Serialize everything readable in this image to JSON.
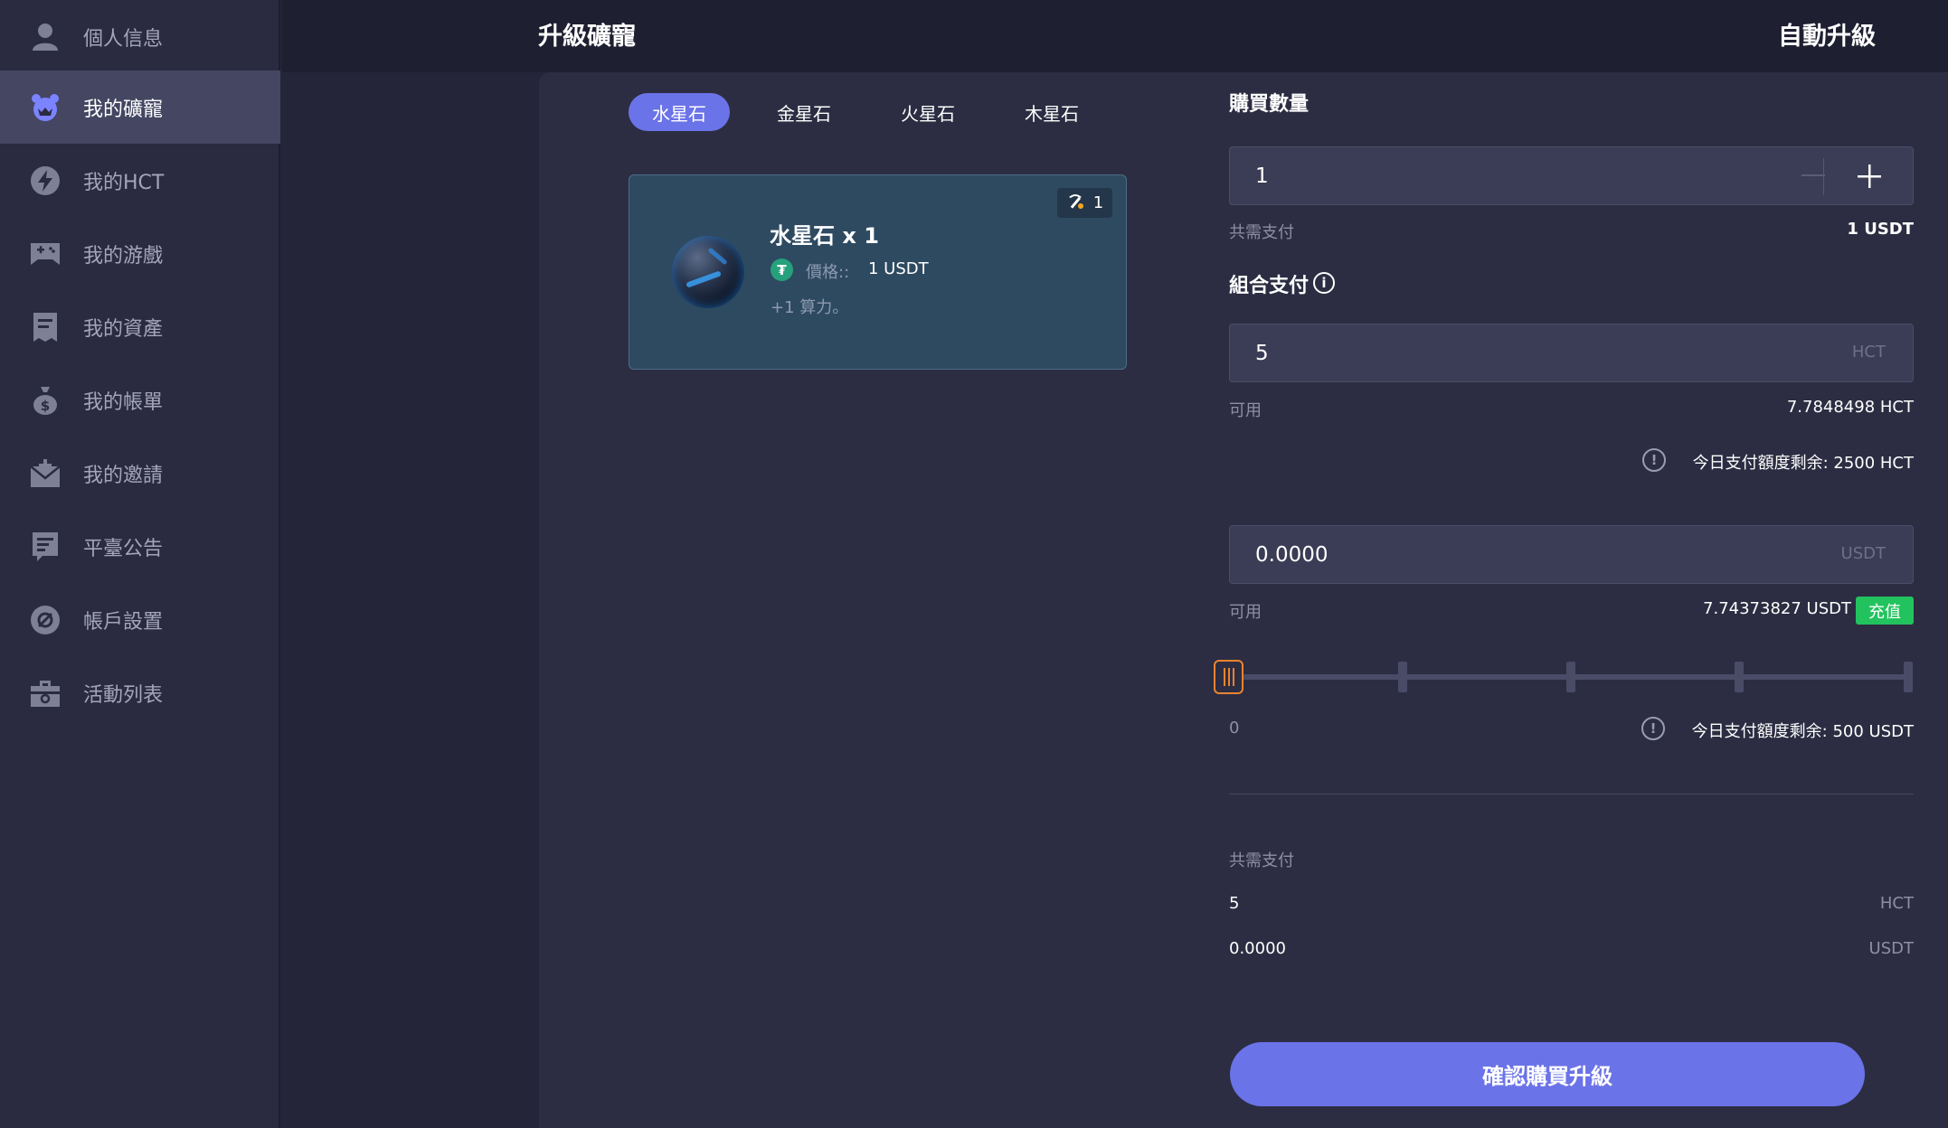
{
  "sidebar": {
    "items": [
      {
        "label": "個人信息",
        "icon": "user-icon"
      },
      {
        "label": "我的礦寵",
        "icon": "pet-icon",
        "active": true
      },
      {
        "label": "我的HCT",
        "icon": "lightning-icon"
      },
      {
        "label": "我的游戲",
        "icon": "gamepad-icon"
      },
      {
        "label": "我的資產",
        "icon": "document-icon"
      },
      {
        "label": "我的帳單",
        "icon": "money-bag-icon"
      },
      {
        "label": "我的邀請",
        "icon": "mail-plus-icon"
      },
      {
        "label": "平臺公告",
        "icon": "announcement-icon"
      },
      {
        "label": "帳戶設置",
        "icon": "settings-icon"
      },
      {
        "label": "活動列表",
        "icon": "toolbox-icon"
      }
    ]
  },
  "header": {
    "title": "升級礦寵",
    "auto_upgrade": "自動升級"
  },
  "tabs": [
    {
      "label": "水星石",
      "active": true
    },
    {
      "label": "金星石"
    },
    {
      "label": "火星石"
    },
    {
      "label": "木星石"
    }
  ],
  "card": {
    "title": "水星石 x 1",
    "coin_symbol": "₮",
    "price_label": "價格::",
    "price_value": "1 USDT",
    "power": "+1 算力。",
    "badge_count": "1"
  },
  "form": {
    "quantity_label": "購買數量",
    "quantity_value": "1",
    "total_label": "共需支付",
    "total_value": "1 USDT",
    "combo_label": "組合支付",
    "hct_value": "5",
    "hct_unit": "HCT",
    "hct_available_label": "可用",
    "hct_available_value": "7.7848498 HCT",
    "hct_limit_text": "今日支付額度剩余: 2500 HCT",
    "usdt_value": "0.0000",
    "usdt_unit": "USDT",
    "usdt_available_label": "可用",
    "usdt_available_value": "7.74373827 USDT",
    "recharge_label": "充值",
    "slider_min": "0",
    "slider_value_fraction": 0,
    "usdt_limit_text": "今日支付額度剩余: 500 USDT",
    "summary_label": "共需支付",
    "summary_hct_value": "5",
    "summary_hct_unit": "HCT",
    "summary_usdt_value": "0.0000",
    "summary_usdt_unit": "USDT",
    "confirm_label": "確認購買升級"
  },
  "colors": {
    "accent": "#6b73e8",
    "slider_handle": "#e98430",
    "recharge": "#22c35e",
    "usdt_coin": "#26a17b"
  }
}
